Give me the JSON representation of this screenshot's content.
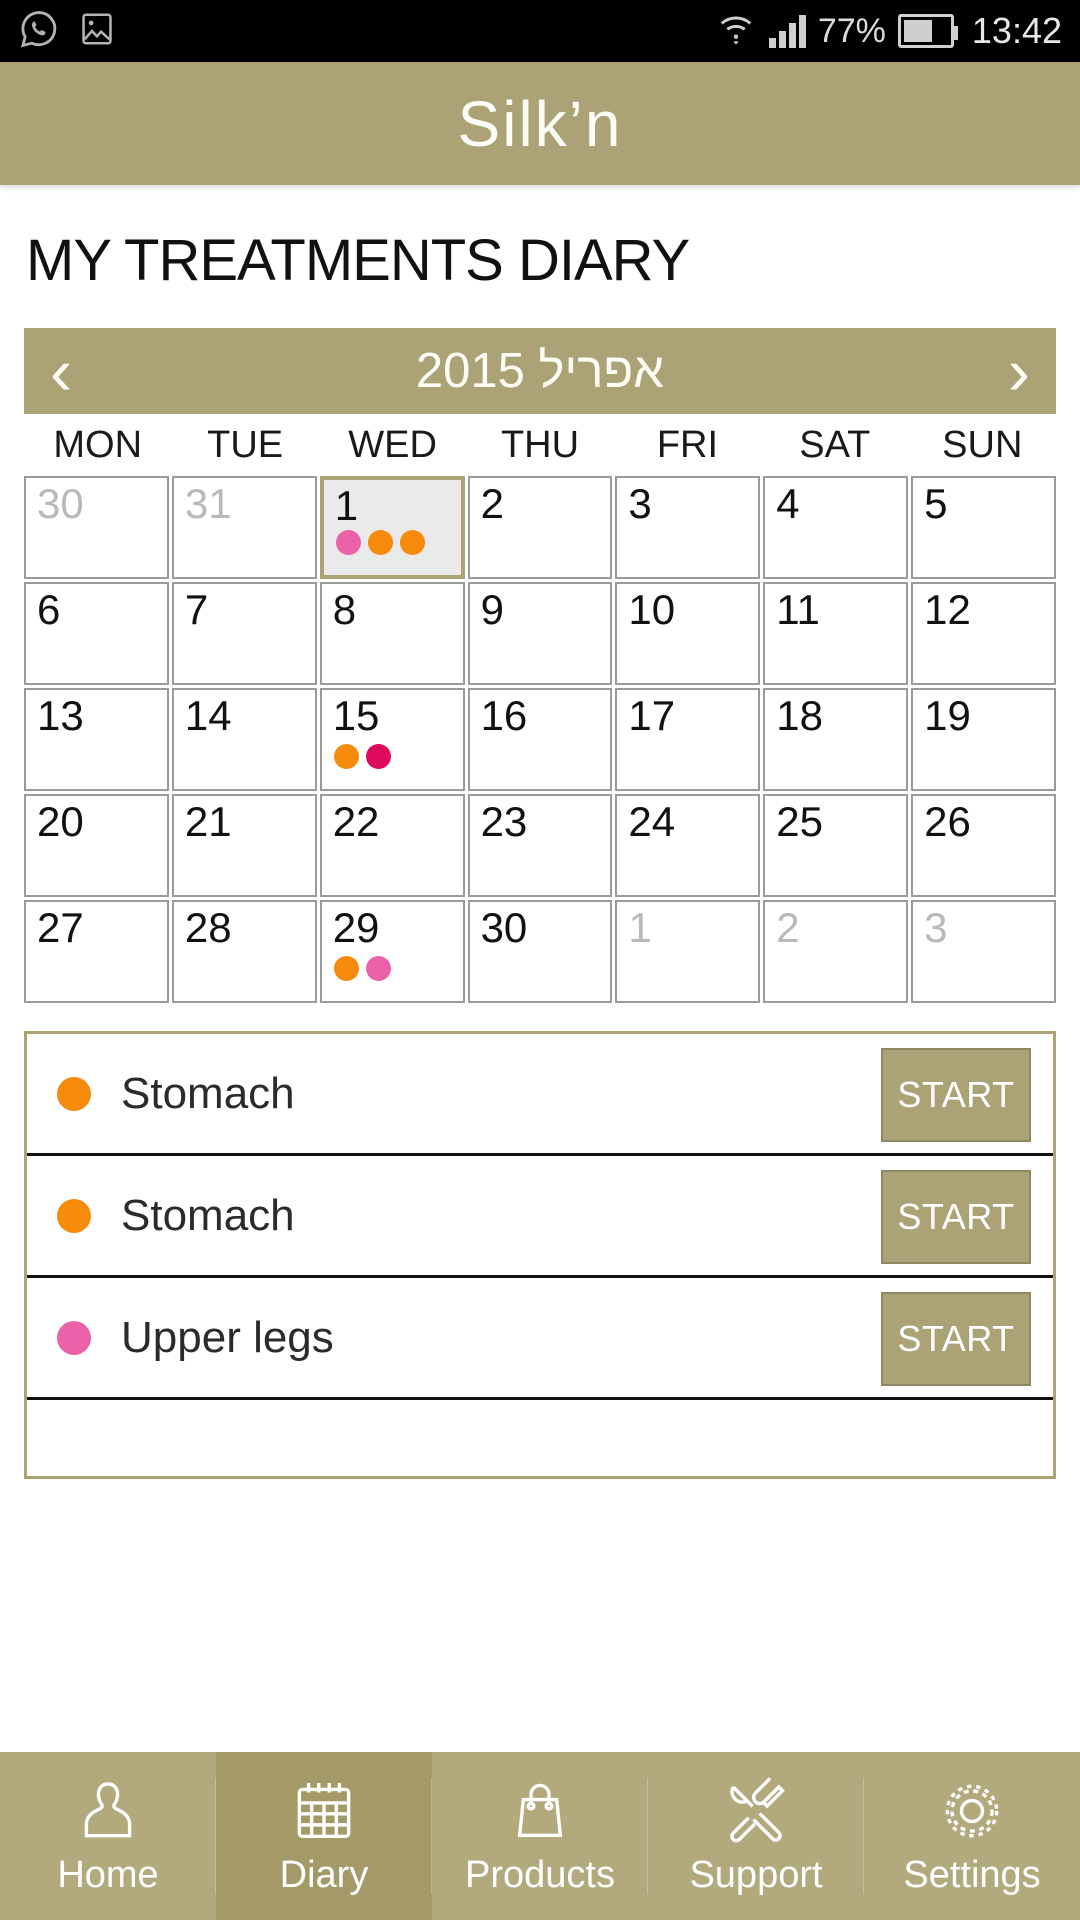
{
  "statusbar": {
    "icons": [
      "whatsapp-icon",
      "image-icon"
    ],
    "wifi": "wifi-icon",
    "signal": "signal-icon",
    "battery_percent": "77%",
    "battery": "battery-icon",
    "time": "13:42"
  },
  "header": {
    "brand": "Silk’n"
  },
  "page": {
    "title": "MY TREATMENTS DIARY"
  },
  "month_nav": {
    "prev": "‹",
    "next": "›",
    "label": "אפריל 2015"
  },
  "weekdays": [
    "MON",
    "TUE",
    "WED",
    "THU",
    "FRI",
    "SAT",
    "SUN"
  ],
  "colors": {
    "brand_gold": "#aba276",
    "nav_gold": "#b2a97c",
    "nav_active": "#a49a68",
    "orange": "#f58a0b",
    "pink": "#ec62a8",
    "crimson": "#de0a5c"
  },
  "calendar": {
    "days": [
      {
        "num": "30",
        "muted": true,
        "dots": []
      },
      {
        "num": "31",
        "muted": true,
        "dots": []
      },
      {
        "num": "1",
        "muted": false,
        "selected": true,
        "dots": [
          "#ec62a8",
          "#f58a0b",
          "#f58a0b"
        ]
      },
      {
        "num": "2",
        "muted": false,
        "dots": []
      },
      {
        "num": "3",
        "muted": false,
        "dots": []
      },
      {
        "num": "4",
        "muted": false,
        "dots": []
      },
      {
        "num": "5",
        "muted": false,
        "dots": []
      },
      {
        "num": "6",
        "muted": false,
        "dots": []
      },
      {
        "num": "7",
        "muted": false,
        "dots": []
      },
      {
        "num": "8",
        "muted": false,
        "dots": []
      },
      {
        "num": "9",
        "muted": false,
        "dots": []
      },
      {
        "num": "10",
        "muted": false,
        "dots": []
      },
      {
        "num": "11",
        "muted": false,
        "dots": []
      },
      {
        "num": "12",
        "muted": false,
        "dots": []
      },
      {
        "num": "13",
        "muted": false,
        "dots": []
      },
      {
        "num": "14",
        "muted": false,
        "dots": []
      },
      {
        "num": "15",
        "muted": false,
        "dots": [
          "#f58a0b",
          "#de0a5c"
        ]
      },
      {
        "num": "16",
        "muted": false,
        "dots": []
      },
      {
        "num": "17",
        "muted": false,
        "dots": []
      },
      {
        "num": "18",
        "muted": false,
        "dots": []
      },
      {
        "num": "19",
        "muted": false,
        "dots": []
      },
      {
        "num": "20",
        "muted": false,
        "dots": []
      },
      {
        "num": "21",
        "muted": false,
        "dots": []
      },
      {
        "num": "22",
        "muted": false,
        "dots": []
      },
      {
        "num": "23",
        "muted": false,
        "dots": []
      },
      {
        "num": "24",
        "muted": false,
        "dots": []
      },
      {
        "num": "25",
        "muted": false,
        "dots": []
      },
      {
        "num": "26",
        "muted": false,
        "dots": []
      },
      {
        "num": "27",
        "muted": false,
        "dots": []
      },
      {
        "num": "28",
        "muted": false,
        "dots": []
      },
      {
        "num": "29",
        "muted": false,
        "dots": [
          "#f58a0b",
          "#ec62a8"
        ]
      },
      {
        "num": "30",
        "muted": false,
        "dots": []
      },
      {
        "num": "1",
        "muted": true,
        "dots": []
      },
      {
        "num": "2",
        "muted": true,
        "dots": []
      },
      {
        "num": "3",
        "muted": true,
        "dots": []
      }
    ]
  },
  "treatments": {
    "rows": [
      {
        "label": "Stomach",
        "color": "#f58a0b",
        "action": "START"
      },
      {
        "label": "Stomach",
        "color": "#f58a0b",
        "action": "START"
      },
      {
        "label": "Upper legs",
        "color": "#ec62a8",
        "action": "START"
      }
    ]
  },
  "bottom_nav": {
    "items": [
      {
        "label": "Home",
        "icon": "person-icon",
        "active": false
      },
      {
        "label": "Diary",
        "icon": "calendar-icon",
        "active": true
      },
      {
        "label": "Products",
        "icon": "bag-icon",
        "active": false
      },
      {
        "label": "Support",
        "icon": "tools-icon",
        "active": false
      },
      {
        "label": "Settings",
        "icon": "gear-icon",
        "active": false
      }
    ]
  }
}
